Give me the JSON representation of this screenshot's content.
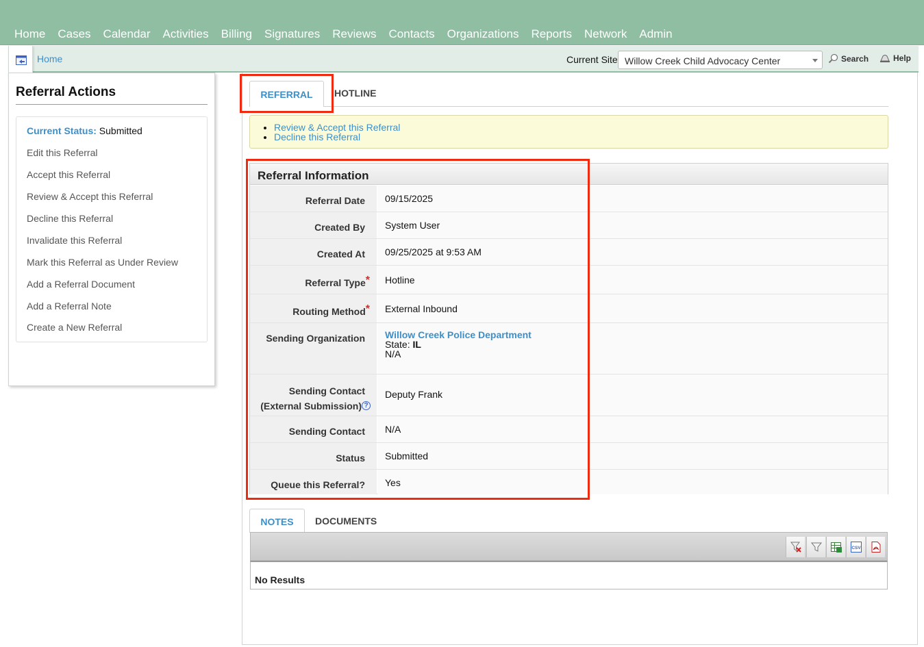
{
  "nav": {
    "items": [
      "Home",
      "Cases",
      "Calendar",
      "Activities",
      "Billing",
      "Signatures",
      "Reviews",
      "Contacts",
      "Organizations",
      "Reports",
      "Network",
      "Admin"
    ]
  },
  "subbar": {
    "home_link": "Home",
    "site_label": "Current Site",
    "site_value": "Willow Creek Child Advocacy Center",
    "search_label": "Search",
    "help_label": "Help"
  },
  "actions": {
    "title": "Referral Actions",
    "status_label": "Current Status:",
    "status_value": "Submitted",
    "items": [
      "Edit this Referral",
      "Accept this Referral",
      "Review & Accept this Referral",
      "Decline this Referral",
      "Invalidate this Referral",
      "Mark this Referral as Under Review",
      "Add a Referral Document",
      "Add a Referral Note",
      "Create a New Referral"
    ]
  },
  "tabs": {
    "referral": "REFERRAL",
    "hotline": "HOTLINE"
  },
  "notice": {
    "links": [
      "Review & Accept this Referral",
      "Decline this Referral"
    ]
  },
  "info": {
    "title": "Referral Information",
    "referral_date_label": "Referral Date",
    "referral_date": "09/15/2025",
    "created_by_label": "Created By",
    "created_by": "System User",
    "created_at_label": "Created At",
    "created_at": "09/25/2025 at 9:53 AM",
    "referral_type_label": "Referral Type",
    "referral_type": "Hotline",
    "routing_method_label": "Routing Method",
    "routing_method": "External Inbound",
    "sending_org_label": "Sending Organization",
    "sending_org_name": "Willow Creek Police Department",
    "sending_org_state_label": "State:",
    "sending_org_state": "IL",
    "sending_org_extra": "N/A",
    "sending_contact_ext_label_1": "Sending Contact",
    "sending_contact_ext_label_2": "(External Submission)",
    "sending_contact_ext": "Deputy Frank",
    "sending_contact_label": "Sending Contact",
    "sending_contact": "N/A",
    "status_label": "Status",
    "status": "Submitted",
    "queue_label": "Queue this Referral?",
    "queue": "Yes",
    "required_mark": "*",
    "help_mark": "?"
  },
  "lower_tabs": {
    "notes": "NOTES",
    "documents": "DOCUMENTS"
  },
  "grid": {
    "empty_text": "No Results",
    "csv_label": "CSV"
  },
  "colors": {
    "nav_bg": "#8fbea3",
    "link": "#3d8fc7",
    "highlight": "#ee2a10",
    "notice_bg": "#fcfbd9"
  }
}
